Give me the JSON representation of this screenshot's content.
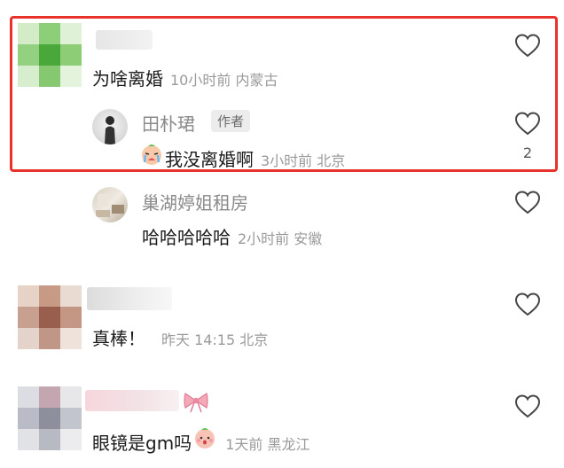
{
  "comments": [
    {
      "body": "为啥离婚",
      "meta": "10小时前 内蒙古",
      "reply": {
        "author": "田朴珺",
        "author_tag": "作者",
        "body": "我没离婚啊",
        "meta": "3小时前 北京",
        "like_count": "2"
      }
    },
    {
      "reply": {
        "author": "巢湖婷姐租房",
        "body": "哈哈哈哈哈",
        "meta": "2小时前 安徽"
      }
    },
    {
      "body": "真棒！",
      "meta": "昨天 14:15 北京"
    },
    {
      "body": "眼镜是gm吗",
      "meta": "1天前 黑龙江"
    }
  ],
  "icons": {
    "like": "heart-outline-icon",
    "crying_emoji": "crying-face-icon",
    "peach_emoji": "peach-face-icon",
    "bow": "pink-bow-icon"
  },
  "colors": {
    "highlight_border": "#e8332c",
    "name_gray": "#8a8a8a",
    "meta_gray": "#9a9a9a"
  }
}
